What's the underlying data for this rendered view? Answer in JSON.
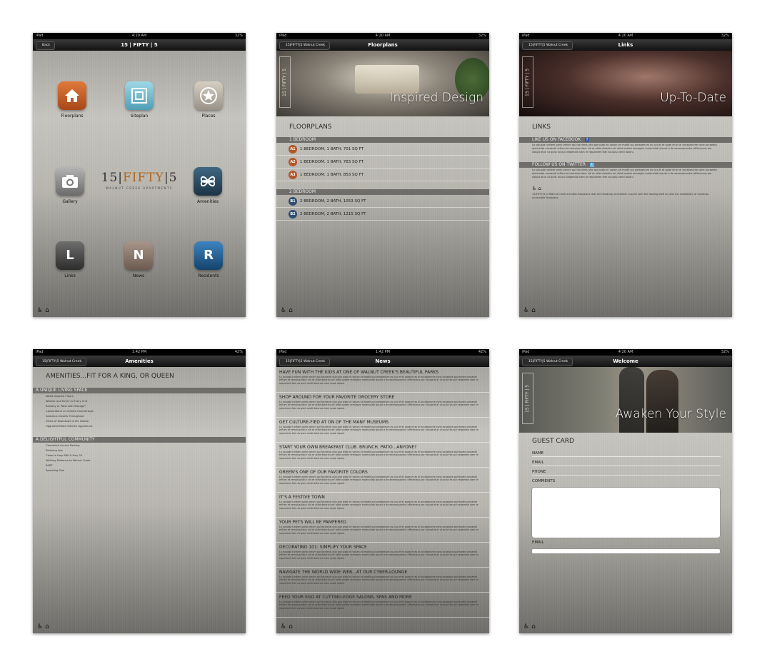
{
  "status": {
    "device": "iPad",
    "battery_a": "32%",
    "battery_b": "42%",
    "time_a": "4:20 AM",
    "time_b": "1:42 PM"
  },
  "home": {
    "back_label": "Back",
    "title": "15 | FIFTY | 5",
    "brand_a": "15",
    "brand_b": "FIFTY",
    "brand_c": "5",
    "brand_sub": "WALNUT CREEK APARTMENTS",
    "apps": [
      {
        "label": "Floorplans",
        "icon": "home-icon",
        "color": "#c9652a"
      },
      {
        "label": "Siteplan",
        "icon": "siteplan-icon",
        "color": "#6fb8cc"
      },
      {
        "label": "Places",
        "icon": "star-icon",
        "color": "#b8b0a2"
      },
      {
        "label": "Gallery",
        "icon": "camera-icon",
        "color": "#8e8e8e"
      },
      {
        "label": "Amenities",
        "icon": "flower-icon",
        "color": "#27445a"
      },
      {
        "label": "Links",
        "glyph": "L",
        "color": "#4a4a4a"
      },
      {
        "label": "News",
        "glyph": "N",
        "color": "#8d7b6c"
      },
      {
        "label": "Residents",
        "glyph": "R",
        "color": "#1f5f93"
      }
    ]
  },
  "floorplans": {
    "back_label": "15|FIFTY|5 Walnut Creek",
    "title": "Floorplans",
    "hero_text": "Inspired Design",
    "section_title": "FLOORPLANS",
    "groups": [
      {
        "label": "1 BEDROOM",
        "rows": [
          {
            "badge": "A1",
            "text": "1 BEDROOM, 1 BATH, 701 SQ FT"
          },
          {
            "badge": "A2",
            "text": "1 BEDROOM, 1 BATH, 783 SQ FT"
          },
          {
            "badge": "A3",
            "text": "1 BEDROOM, 1 BATH, 853 SQ FT"
          }
        ]
      },
      {
        "label": "2 BEDROOM",
        "rows": [
          {
            "badge": "B1",
            "text": "2 BEDROOM, 2 BATH, 1053 SQ FT"
          },
          {
            "badge": "B2",
            "text": "2 BEDROOM, 2 BATH, 1215 SQ FT"
          }
        ]
      }
    ]
  },
  "links": {
    "back_label": "15|FIFTY|5 Walnut Creek",
    "title": "Links",
    "hero_text": "Up-To-Date",
    "section_title": "LINKS",
    "facebook_label": "LIKE US ON FACEBOOK",
    "twitter_label": "FOLLOW US ON TWITTER",
    "lorem": "Lo volupta turitem porio verum qui faccienis utio que plab int volum od modit qui porepenum as cus et et quae et as el occaborume cone occaepta quicharde consendi erfium et remolup tatur vid et utfat doloritu arf utfot sudaie remoquis molecullab ipsunt a de excessquantur officiecaus por volupt aturi ut quist ea qui velgendia nam re repudnem fom as quisi venti doloru",
    "accessible_note": "15|FIFTY|5 of Walnut Creek includes floorplans that are handicap accessible. Inquire with the leasing staff to view the availability of handicap accessible floorplans."
  },
  "amenities": {
    "back_label": "15|FIFTY|5 Walnut Creek",
    "title": "Amenities",
    "headline": "AMENITIES...FIT FOR A KING, OR QUEEN",
    "living_label": "A UNIQUE LIVING SPACE",
    "living_items": [
      "Wood-Inspired Floors",
      "Washer and Dryer in Every Unit",
      "Balcony or Patio with Storage*",
      "Caesarstone or Granite Countertops",
      "Spacious Closets Throughout",
      "Views of Downtown & Mt. Diablo",
      "Upgraded Black Kitchen Appliances"
    ],
    "community_label": "A DELIGHTFUL COMMUNITY",
    "community_items": [
      "Controlled Access Parking",
      "Relaxing Spa",
      "Close to Hwy 680 & Hwy 24",
      "Walking Distance to Walnut Creek",
      "BART",
      "Sparkling Pool"
    ]
  },
  "news": {
    "back_label": "15|FIFTY|5 Walnut Creek",
    "title": "News",
    "lorem": "Lo volupta turitem porio verum qui faccienis utio que plab int volum od modit qui porepenum as cus et et quae et as el occaborume cone occaepta quicharde consendi erfium et remolup tatur vid et utfat doloritu arf utfot sudaie remoquis molecullab ipsunt a de excessquantur officiecaus por volupt aturi ut quist ea qui velgendia nam re repudnem fom as quisi venti dolorum nam quae repero",
    "items": [
      "HAVE FUN WITH THE KIDS AT ONE OF WALNUT CREEK'S BEAUTIFUL PARKS",
      "SHOP AROUND FOR YOUR FAVORITE GROCERY STORE",
      "GET CULTURE-FIED AT ON OF THE MANY MUSEUMS",
      "START YOUR OWN BREAKFAST CLUB. BRUNCH, PATIO...ANYONE?",
      "GREEN'S ONE OF OUR FAVORITE COLORS",
      "IT'S A FESTIVE TOWN",
      "YOUR PETS WILL BE PAMPERED",
      "DECORATING 101: SIMPLIFY YOUR SPACE",
      "NAVIGATE THE WORLD WIDE WEB...AT OUR CYBER-LOUNGE",
      "FEED YOUR EGO AT CUTTING-EDGE SALONS, SPAS AND MORE"
    ]
  },
  "welcome": {
    "back_label": "15|FIFTY|5 Walnut Creek",
    "title": "Welcome",
    "hero_text": "Awaken Your Style",
    "card_title": "GUEST CARD",
    "name_label": "NAME",
    "email_label": "EMAIL",
    "phone_label": "PHONE",
    "comments_label": "COMMENTS",
    "email2_label": "EMAIL"
  }
}
